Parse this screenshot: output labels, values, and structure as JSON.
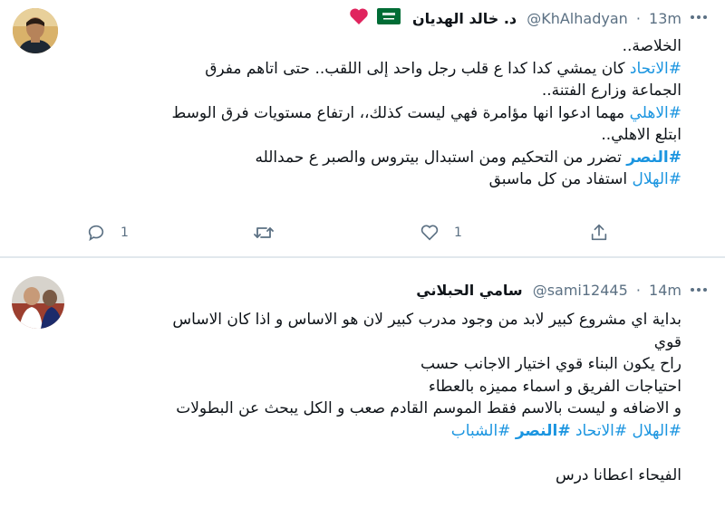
{
  "tweet1": {
    "display_name": "د. خالد الهديان",
    "handle": "@KhAlhadyan",
    "separator": "·",
    "time": "13m",
    "lines": [
      {
        "parts": [
          {
            "t": "الخلاصة..",
            "h": false
          }
        ]
      },
      {
        "parts": [
          {
            "t": "#الاتحاد",
            "h": true
          },
          {
            "t": " كان يمشي كدا كدا ع قلب رجل واحد  إلى اللقب.. حتى اتاهم مفرق",
            "h": false
          }
        ]
      },
      {
        "parts": [
          {
            "t": "الجماعة وزارع الفتنة..",
            "h": false
          }
        ]
      },
      {
        "parts": [
          {
            "t": "#الاهلي",
            "h": true
          },
          {
            "t": " مهما ادعوا انها مؤامرة فهي ليست كذلك،، ارتفاع مستويات فرق الوسط",
            "h": false
          }
        ]
      },
      {
        "parts": [
          {
            "t": "ابتلع الاهلي..",
            "h": false
          }
        ]
      },
      {
        "parts": [
          {
            "t": "#النصر",
            "h": true,
            "b": true
          },
          {
            "t": "  تضرر من التحكيم ومن استبدال بيتروس والصبر ع حمدالله",
            "h": false
          }
        ]
      },
      {
        "parts": [
          {
            "t": "#الهلال",
            "h": true
          },
          {
            "t": " استفاد من كل ماسبق",
            "h": false
          }
        ]
      }
    ],
    "reply_count": "1",
    "like_count": "1"
  },
  "tweet2": {
    "display_name": "سامي الحبلاني",
    "handle": "@sami12445",
    "separator": "·",
    "time": "14m",
    "lines": [
      {
        "parts": [
          {
            "t": "بداية اي مشروع كبير لابد من وجود مدرب كبير لان هو الاساس و اذا كان الاساس",
            "h": false
          }
        ]
      },
      {
        "parts": [
          {
            "t": "قوي",
            "h": false
          }
        ]
      },
      {
        "parts": [
          {
            "t": "راح يكون البناء قوي اختيار الاجانب حسب",
            "h": false
          }
        ]
      },
      {
        "parts": [
          {
            "t": "احتياجات الفريق و اسماء مميزه بالعطاء",
            "h": false
          }
        ]
      },
      {
        "parts": [
          {
            "t": "و الاضافه و ليست بالاسم فقط الموسم القادم صعب و الكل يبحث عن البطولات",
            "h": false
          }
        ]
      },
      {
        "parts": [
          {
            "t": "#الهلال",
            "h": true
          },
          {
            "t": " ",
            "h": false
          },
          {
            "t": "#الاتحاد",
            "h": true
          },
          {
            "t": " ",
            "h": false
          },
          {
            "t": "#النصر",
            "h": true,
            "b": true
          },
          {
            "t": " ",
            "h": false
          },
          {
            "t": "#الشباب",
            "h": true
          }
        ]
      },
      {
        "parts": [
          {
            "t": "",
            "h": false
          }
        ]
      },
      {
        "parts": [
          {
            "t": "الفيحاء اعطانا درس",
            "h": false
          }
        ]
      }
    ]
  },
  "colors": {
    "hashtag": "#1b95e0",
    "muted": "#5b7083",
    "like": "#e0245e",
    "flag": "#006c35"
  }
}
